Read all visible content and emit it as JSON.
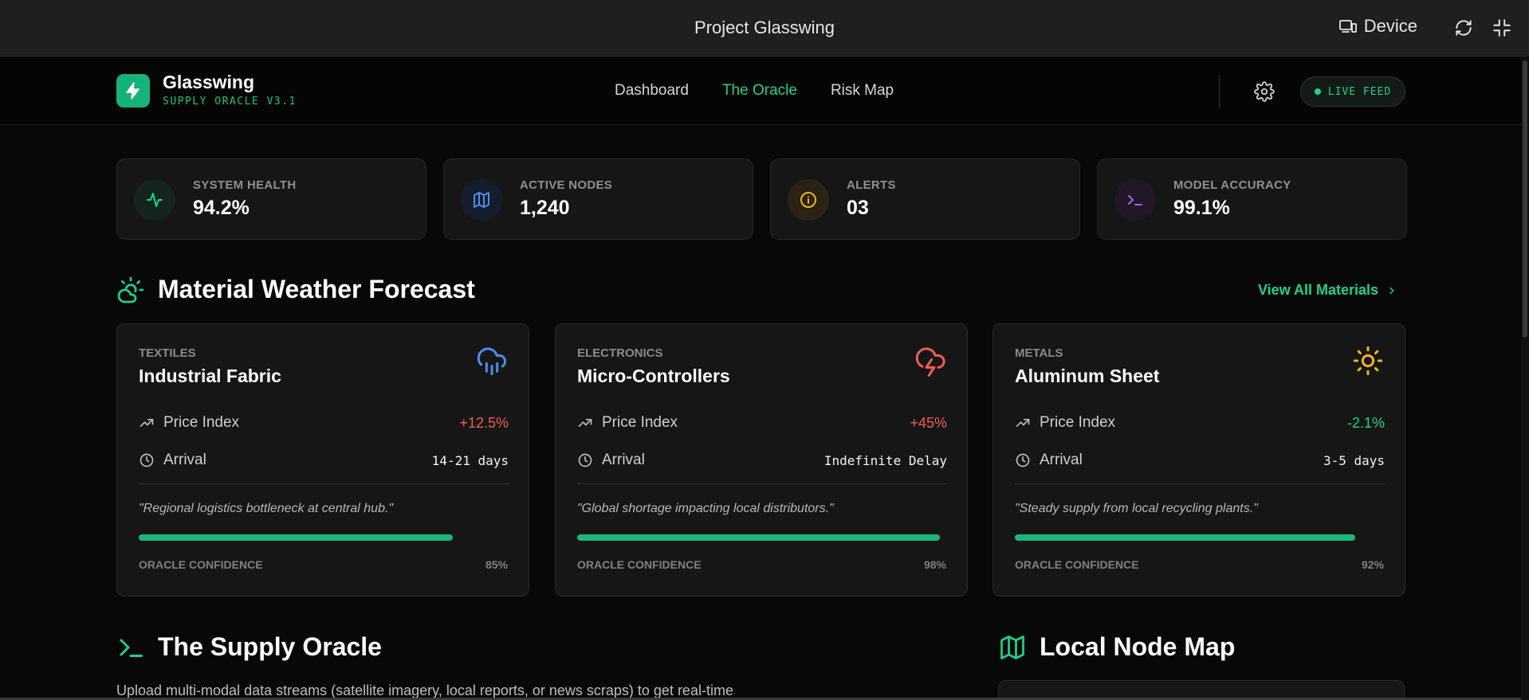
{
  "window": {
    "title": "Project Glasswing",
    "device_label": "Device"
  },
  "brand": {
    "name": "Glasswing",
    "subtitle": "SUPPLY ORACLE V3.1"
  },
  "nav": {
    "items": [
      {
        "label": "Dashboard",
        "active": false
      },
      {
        "label": "The Oracle",
        "active": true
      },
      {
        "label": "Risk Map",
        "active": false
      }
    ]
  },
  "live_feed": {
    "label": "LIVE FEED"
  },
  "stats": [
    {
      "label": "SYSTEM HEALTH",
      "value": "94.2%",
      "icon": "activity-icon",
      "color": "#1fd18e"
    },
    {
      "label": "ACTIVE NODES",
      "value": "1,240",
      "icon": "map-icon",
      "color": "#4a8df0"
    },
    {
      "label": "ALERTS",
      "value": "03",
      "icon": "info-icon",
      "color": "#f0b429"
    },
    {
      "label": "MODEL ACCURACY",
      "value": "99.1%",
      "icon": "terminal-icon",
      "color": "#a55ff0"
    }
  ],
  "forecast": {
    "title": "Material Weather Forecast",
    "view_all": "View All Materials",
    "row_labels": {
      "price": "Price Index",
      "arrival": "Arrival",
      "confidence": "ORACLE CONFIDENCE"
    },
    "materials": [
      {
        "category": "TEXTILES",
        "name": "Industrial Fabric",
        "weather": "rain-cloud-icon",
        "price_change": "+12.5%",
        "price_color": "#f25c54",
        "arrival": "14-21 days",
        "note": "\"Regional logistics bottleneck at central hub.\"",
        "confidence": "85%",
        "confidence_value": 0.85
      },
      {
        "category": "ELECTRONICS",
        "name": "Micro-Controllers",
        "weather": "storm-cloud-icon",
        "price_change": "+45%",
        "price_color": "#f25c54",
        "arrival": "Indefinite Delay",
        "note": "\"Global shortage impacting local distributors.\"",
        "confidence": "98%",
        "confidence_value": 0.98
      },
      {
        "category": "METALS",
        "name": "Aluminum Sheet",
        "weather": "sun-icon",
        "price_change": "-2.1%",
        "price_color": "#1fd18e",
        "arrival": "3-5 days",
        "note": "\"Steady supply from local recycling plants.\"",
        "confidence": "92%",
        "confidence_value": 0.92
      }
    ]
  },
  "oracle": {
    "title": "The Supply Oracle",
    "description": "Upload multi-modal data streams (satellite imagery, local reports, or news scraps) to get real-time"
  },
  "node_map": {
    "title": "Local Node Map"
  }
}
